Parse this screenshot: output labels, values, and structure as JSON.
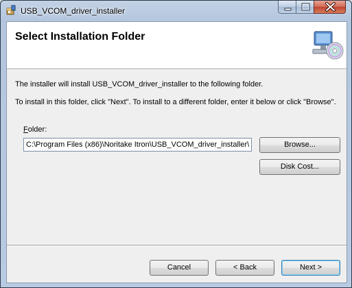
{
  "window": {
    "title": "USB_VCOM_driver_installer"
  },
  "header": {
    "title": "Select Installation Folder"
  },
  "body": {
    "line1": "The installer will install USB_VCOM_driver_installer to the following folder.",
    "line2": "To install in this folder, click \"Next\". To install to a different folder, enter it below or click \"Browse\"."
  },
  "folder": {
    "label_mnemonic": "F",
    "label_rest": "older:",
    "value": "C:\\Program Files (x86)\\Noritake Itron\\USB_VCOM_driver_installer\\"
  },
  "buttons": {
    "browse": "Browse...",
    "disk_cost": "Disk Cost...",
    "cancel": "Cancel",
    "back": "< Back",
    "next": "Next >"
  },
  "icons": {
    "app": "installer-box-icon",
    "header": "computer-cd-icon"
  }
}
